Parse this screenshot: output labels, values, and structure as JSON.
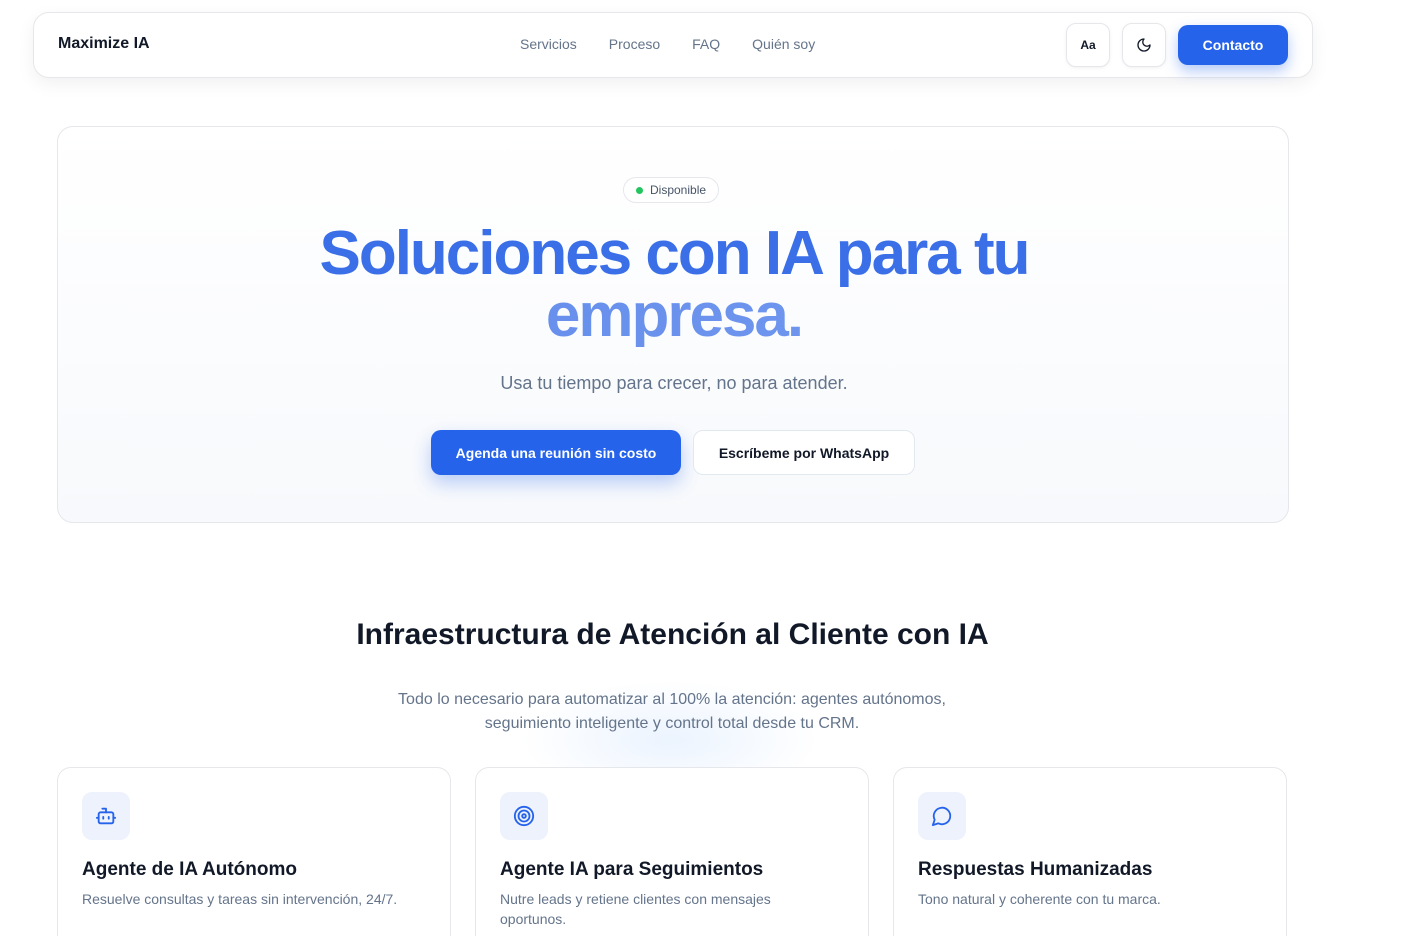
{
  "nav": {
    "brand": "Maximize IA",
    "links": [
      "Servicios",
      "Proceso",
      "FAQ",
      "Quién soy"
    ],
    "font_button": "Aa",
    "theme_icon": "moon-icon",
    "contact_label": "Contacto"
  },
  "hero": {
    "badge": "Disponible",
    "title_line1": "Soluciones con IA para tu",
    "title_line2": "empresa.",
    "subtitle": "Usa tu tiempo para crecer, no para atender.",
    "primary_cta": "Agenda una reunión sin costo",
    "secondary_cta": "Escríbeme por WhatsApp"
  },
  "services": {
    "title": "Infraestructura de Atención al Cliente con IA",
    "subtitle_line1": "Todo lo necesario para automatizar al 100% la atención: agentes autónomos,",
    "subtitle_line2": "seguimiento inteligente y control total desde tu CRM.",
    "cards": [
      {
        "icon": "robot-icon",
        "title": "Agente de IA Autónomo",
        "description": "Resuelve consultas y tareas sin intervención, 24/7."
      },
      {
        "icon": "target-icon",
        "title": "Agente IA para Seguimientos",
        "description": "Nutre leads y retiene clientes con mensajes oportunos."
      },
      {
        "icon": "chat-bubble-icon",
        "title": "Respuestas Humanizadas",
        "description": "Tono natural y coherente con tu marca."
      }
    ]
  },
  "colors": {
    "accent": "#2563eb",
    "badge_dot": "#22c55e",
    "muted_text": "#64748b"
  }
}
